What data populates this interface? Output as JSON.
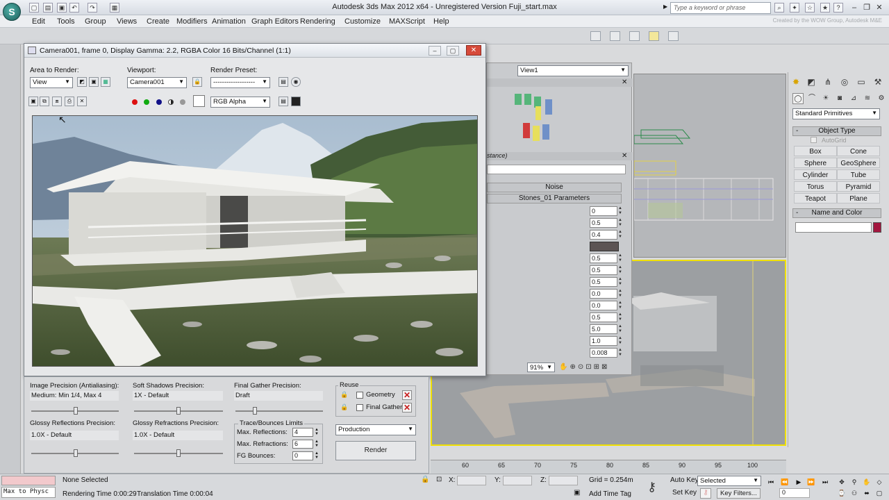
{
  "app": {
    "title": "Autodesk 3ds Max  2012 x64    - Unregistered Version    Fuji_start.max",
    "logo": "3ds-max-logo",
    "search_placeholder": "Type a keyword or phrase",
    "credits": "Created by the WOW Group, Autodesk M&E"
  },
  "menu": [
    "Edit",
    "Tools",
    "Group",
    "Views",
    "Create",
    "Modifiers",
    "Animation",
    "Graph Editors",
    "Rendering",
    "Customize",
    "MAXScript",
    "Help"
  ],
  "render_window": {
    "title": "Camera001, frame 0, Display Gamma: 2.2, RGBA Color 16 Bits/Channel (1:1)",
    "area_to_render_label": "Area to Render:",
    "area_to_render_value": "View",
    "viewport_label": "Viewport:",
    "viewport_value": "Camera001",
    "render_preset_label": "Render Preset:",
    "render_preset_value": "-------------------",
    "channel_value": "RGB Alpha"
  },
  "render_settings": {
    "image_precision_label": "Image Precision (Antialiasing):",
    "image_precision_value": "Medium: Min 1/4, Max 4",
    "soft_shadows_label": "Soft Shadows Precision:",
    "soft_shadows_value": "1X - Default",
    "final_gather_label": "Final Gather Precision:",
    "final_gather_value": "Draft",
    "glossy_reflections_label": "Glossy Reflections Precision:",
    "glossy_reflections_value": "1.0X - Default",
    "glossy_refractions_label": "Glossy Refractions Precision:",
    "glossy_refractions_value": "1.0X - Default",
    "trace_label": "Trace/Bounces Limits",
    "max_reflections_label": "Max. Reflections:",
    "max_reflections_value": "4",
    "max_refractions_label": "Max. Refractions:",
    "max_refractions_value": "6",
    "fg_bounces_label": "FG Bounces:",
    "fg_bounces_value": "0",
    "reuse_label": "Reuse",
    "geometry_label": "Geometry",
    "final_gather_reuse_label": "Final Gather",
    "mode_value": "Production",
    "render_button": "Render"
  },
  "material_editor": {
    "view_value": "View1",
    "instance_label": "stance)",
    "noise_label": "Noise",
    "params_label": "Stones_01 Parameters",
    "values": [
      "0",
      "0.5",
      "0.4",
      "",
      "0.5",
      "0.5",
      "0.5",
      "0.0",
      "0.0",
      "0.5",
      "5.0",
      "1.0",
      "0.008"
    ],
    "zoom_value": "91%"
  },
  "command_panel": {
    "category_value": "Standard Primitives",
    "object_type_label": "Object Type",
    "autogrid_label": "AutoGrid",
    "primitives": [
      "Box",
      "Cone",
      "Sphere",
      "GeoSphere",
      "Cylinder",
      "Tube",
      "Torus",
      "Pyramid",
      "Teapot",
      "Plane"
    ],
    "name_color_label": "Name and Color",
    "object_color": "#a3173f"
  },
  "timeline": {
    "ticks": [
      "60",
      "65",
      "70",
      "75",
      "80",
      "85",
      "90",
      "95",
      "100"
    ]
  },
  "status": {
    "maxscript_text": "Max to Physc",
    "selection_text": "None Selected",
    "rendering_time": "Rendering Time  0:00:29",
    "translation_time": "Translation Time  0:00:04",
    "x_label": "X:",
    "y_label": "Y:",
    "z_label": "Z:",
    "grid_text": "Grid = 0.254m",
    "add_time_tag": "Add Time Tag",
    "auto_key": "Auto Key",
    "set_key": "Set Key",
    "selected_value": "Selected",
    "key_filters": "Key Filters...",
    "frame_value": "0"
  },
  "colors": {
    "accent_yellow": "#f0e000",
    "close_red": "#d64a3a"
  }
}
